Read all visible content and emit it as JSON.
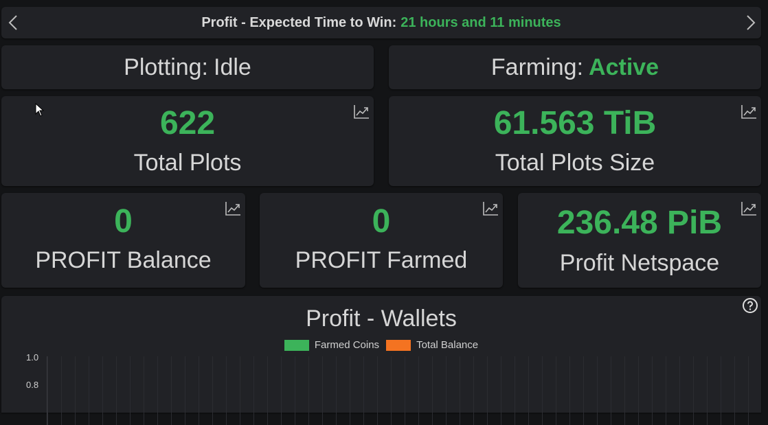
{
  "header": {
    "title_prefix": "Profit - Expected Time to Win:",
    "time_to_win": "21 hours and 11 minutes"
  },
  "plotting": {
    "label": "Plotting:",
    "value": "Idle"
  },
  "farming": {
    "label": "Farming:",
    "value": "Active"
  },
  "stats": {
    "total_plots": {
      "value": "622",
      "label": "Total Plots"
    },
    "total_plots_size": {
      "value": "61.563 TiB",
      "label": "Total Plots Size"
    },
    "profit_balance": {
      "value": "0",
      "label": "PROFIT Balance"
    },
    "profit_farmed": {
      "value": "0",
      "label": "PROFIT Farmed"
    },
    "profit_netspace": {
      "value": "236.48 PiB",
      "label": "Profit Netspace"
    }
  },
  "wallets": {
    "title": "Profit - Wallets",
    "legend": [
      {
        "label": "Farmed Coins",
        "color": "#3cb35a"
      },
      {
        "label": "Total Balance",
        "color": "#f47321"
      }
    ],
    "y_ticks": [
      "1.0",
      "0.8"
    ]
  },
  "colors": {
    "accent": "#3cb35a",
    "card": "#212226",
    "background": "#131416"
  },
  "icons": [
    "chevron-left-icon",
    "chevron-right-icon",
    "chart-trend-icon",
    "help-circle-icon"
  ]
}
